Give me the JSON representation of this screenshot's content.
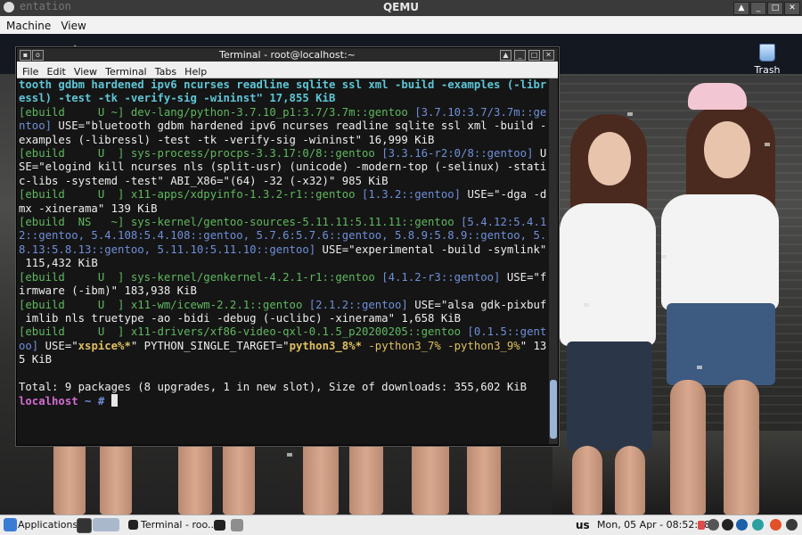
{
  "qemu": {
    "title": "QEMU",
    "ghost_text": "entation",
    "menu": [
      "Machine",
      "View"
    ]
  },
  "desktop": {
    "trash_label": "Trash"
  },
  "terminal": {
    "title": "Terminal - root@localhost:~",
    "menu": [
      "File",
      "Edit",
      "View",
      "Terminal",
      "Tabs",
      "Help"
    ],
    "prompt_host": "localhost",
    "prompt_dir": "~ #",
    "summary": "Total: 9 packages (8 upgrades, 1 in new slot), Size of downloads: 355,602 KiB",
    "lines": {
      "l1": "tooth gdbm hardened ipv6 ncurses readline sqlite ssl xml -build -examples (-libr",
      "l2a": "essl) -test -tk -verify-sig -wininst\" 17,855 KiB",
      "l3_tag": "[ebuild     U ~] ",
      "l3_pkg": "dev-lang/python-3.7.10_p1:3.7/3.7m::gentoo",
      "l3_ver": " [3.7.10:3.7/3.7m::ge",
      "l4_ver": "ntoo]",
      "l4_rest": " USE=\"bluetooth gdbm hardened ipv6 ncurses readline sqlite ssl xml -build -",
      "l5": "examples (-libressl) -test -tk -verify-sig -wininst\" 16,999 KiB",
      "l6_tag": "[ebuild     U  ] ",
      "l6_pkg": "sys-process/procps-3.3.17:0/8::gentoo",
      "l6_ver": " [3.3.16-r2:0/8::gentoo]",
      "l6_rest": " U",
      "l7": "SE=\"elogind kill ncurses nls (split-usr) (unicode) -modern-top (-selinux) -stati",
      "l8": "c-libs -systemd -test\" ABI_X86=\"(64) -32 (-x32)\" 985 KiB",
      "l9_tag": "[ebuild     U  ] ",
      "l9_pkg": "x11-apps/xdpyinfo-1.3.2-r1::gentoo",
      "l9_ver": " [1.3.2::gentoo]",
      "l9_rest": " USE=\"-dga -d",
      "l10": "mx -xinerama\" 139 KiB",
      "l11_tag": "[ebuild  NS   ~] ",
      "l11_pkg": "sys-kernel/gentoo-sources-5.11.11:5.11.11::gentoo",
      "l11_ver": " [5.4.12:5.4.1",
      "l12": "2::gentoo, 5.4.108:5.4.108::gentoo, 5.7.6:5.7.6::gentoo, 5.8.9:5.8.9::gentoo, 5.",
      "l13": "8.13:5.8.13::gentoo, 5.11.10:5.11.10::gentoo]",
      "l13_rest": " USE=\"experimental -build -symlink\"",
      "l14": " 115,432 KiB",
      "l15_tag": "[ebuild     U  ] ",
      "l15_pkg": "sys-kernel/genkernel-4.2.1-r1::gentoo",
      "l15_ver": " [4.1.2-r3::gentoo]",
      "l15_rest": " USE=\"f",
      "l16": "irmware (-ibm)\" 183,938 KiB",
      "l17_tag": "[ebuild     U  ] ",
      "l17_pkg": "x11-wm/icewm-2.2.1::gentoo",
      "l17_ver": " [2.1.2::gentoo]",
      "l17_rest": " USE=\"alsa gdk-pixbuf",
      "l18": " imlib nls truetype -ao -bidi -debug (-uclibc) -xinerama\" 1,658 KiB",
      "l19_tag": "[ebuild     U  ] ",
      "l19_pkg": "x11-drivers/xf86-video-qxl-0.1.5_p20200205::gentoo",
      "l19_ver": " [0.1.5::gent",
      "l20_ver": "oo]",
      "l20_a": " USE=\"",
      "l20_b": "xspice%*",
      "l20_c": "\" PYTHON_SINGLE_TARGET=\"",
      "l20_d": "python3_8%*",
      "l20_e": " -python3_7% -python3_9%",
      "l20_f": "\" 13",
      "l21": "5 KiB"
    }
  },
  "taskbar": {
    "applications": "Applications",
    "task_terminal": "Terminal - roo...",
    "keyboard_layout": "us",
    "clock": "Mon, 05 Apr - 08:52:48"
  }
}
